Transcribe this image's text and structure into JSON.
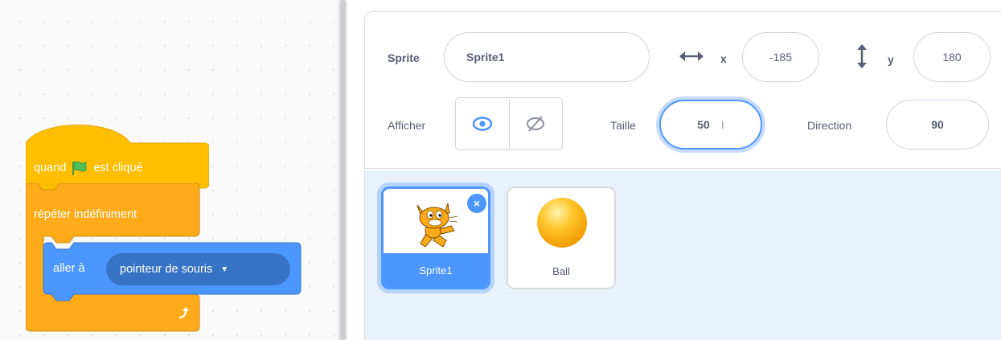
{
  "code": {
    "hat_prefix": "quand",
    "hat_suffix": "est cliqué",
    "repeat_label": "répéter indéfiniment",
    "goto_label": "aller à",
    "goto_target": "pointeur de souris",
    "colors": {
      "events": "#ffbf00",
      "events_dark": "#e6a700",
      "control": "#ffab19",
      "motion": "#4c97ff",
      "flag": "#4cbf56"
    }
  },
  "sprite_info": {
    "sprite_label": "Sprite",
    "sprite_name": "Sprite1",
    "x_label": "x",
    "x_value": "-185",
    "y_label": "y",
    "y_value": "180",
    "show_label": "Afficher",
    "size_label": "Taille",
    "size_value": "50",
    "direction_label": "Direction",
    "direction_value": "90"
  },
  "sprites": [
    {
      "name": "Sprite1",
      "selected": true,
      "icon": "cat-sprite-icon"
    },
    {
      "name": "Ball",
      "selected": false,
      "icon": "ball-sprite-icon"
    }
  ],
  "delete_glyph": "×"
}
